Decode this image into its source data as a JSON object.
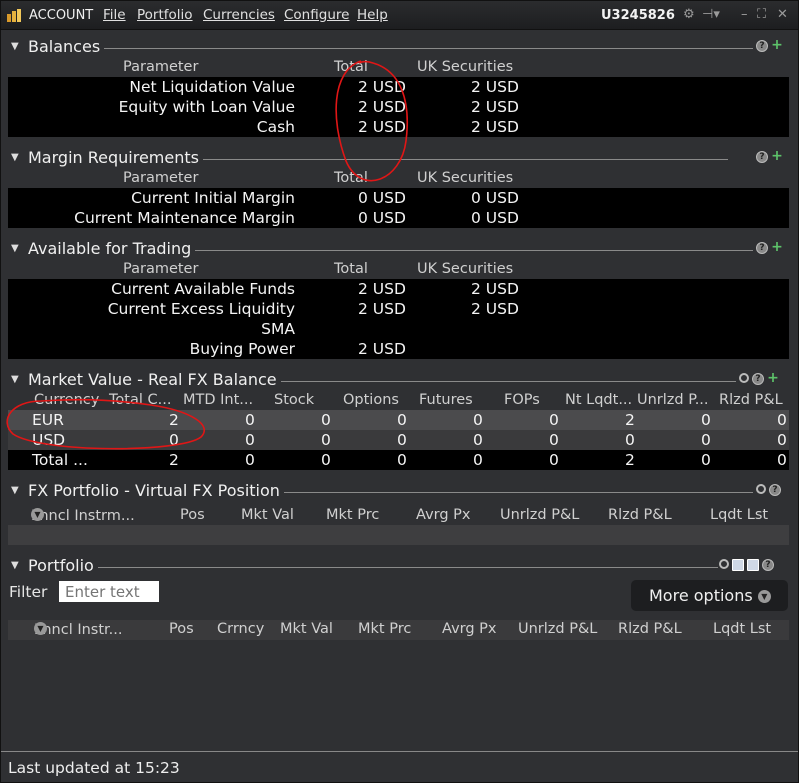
{
  "titlebar": {
    "account_label": "ACCOUNT",
    "menu": [
      "File",
      "Portfolio",
      "Currencies",
      "Configure",
      "Help"
    ],
    "account_id": "U3245826"
  },
  "balances": {
    "title": "Balances",
    "headers": [
      "Parameter",
      "Total",
      "UK Securities"
    ],
    "rows": [
      {
        "param": "Net Liquidation Value",
        "total": "2 USD",
        "uk": "2 USD"
      },
      {
        "param": "Equity with Loan Value",
        "total": "2 USD",
        "uk": "2 USD"
      },
      {
        "param": "Cash",
        "total": "2 USD",
        "uk": "2 USD"
      }
    ]
  },
  "margin": {
    "title": "Margin Requirements",
    "headers": [
      "Parameter",
      "Total",
      "UK Securities"
    ],
    "rows": [
      {
        "param": "Current Initial Margin",
        "total": "0 USD",
        "uk": "0 USD"
      },
      {
        "param": "Current Maintenance Margin",
        "total": "0 USD",
        "uk": "0 USD"
      }
    ]
  },
  "available": {
    "title": "Available for Trading",
    "headers": [
      "Parameter",
      "Total",
      "UK Securities"
    ],
    "rows": [
      {
        "param": "Current Available Funds",
        "total": "2 USD",
        "uk": "2 USD"
      },
      {
        "param": "Current Excess Liquidity",
        "total": "2 USD",
        "uk": "2 USD"
      },
      {
        "param": "SMA",
        "total": "",
        "uk": ""
      },
      {
        "param": "Buying Power",
        "total": "2 USD",
        "uk": ""
      }
    ]
  },
  "market_value": {
    "title": "Market Value - Real FX Balance",
    "headers": [
      "Currency",
      "Total C...",
      "MTD Int...",
      "Stock",
      "Options",
      "Futures",
      "FOPs",
      "Nt Lqdt...",
      "Unrlzd P...",
      "Rlzd P&L"
    ],
    "rows": [
      {
        "cells": [
          "EUR",
          "2",
          "0",
          "0",
          "0",
          "0",
          "0",
          "2",
          "0",
          "0"
        ]
      },
      {
        "cells": [
          "USD",
          "0",
          "0",
          "0",
          "0",
          "0",
          "0",
          "0",
          "0",
          "0"
        ]
      },
      {
        "cells": [
          "Total ...",
          "2",
          "0",
          "0",
          "0",
          "0",
          "0",
          "2",
          "0",
          "0"
        ]
      }
    ]
  },
  "fx_portfolio": {
    "title": "FX Portfolio - Virtual FX Position",
    "headers": [
      "Fnncl Instrm...",
      "Pos",
      "Mkt Val",
      "Mkt Prc",
      "Avrg Px",
      "Unrlzd P&L",
      "Rlzd P&L",
      "Lqdt Lst"
    ]
  },
  "portfolio": {
    "title": "Portfolio",
    "filter_label": "Filter",
    "filter_placeholder": "Enter text",
    "more_options": "More options",
    "headers": [
      "Fnncl Instr...",
      "Pos",
      "Crrncy",
      "Mkt Val",
      "Mkt Prc",
      "Avrg Px",
      "Unrlzd P&L",
      "Rlzd P&L",
      "Lqdt Lst"
    ]
  },
  "status": {
    "text": "Last updated at 15:23"
  },
  "colors": {
    "annotation": "#e01616",
    "plus_icon": "#5dc36a"
  }
}
